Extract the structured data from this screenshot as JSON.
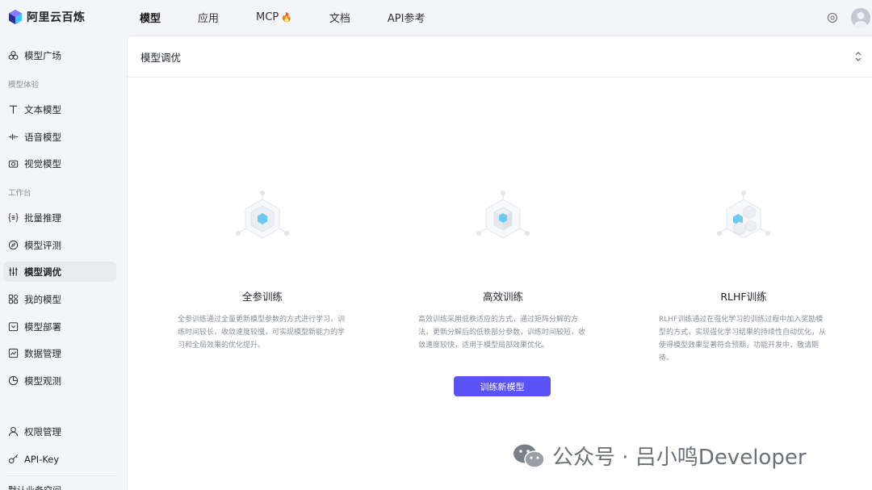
{
  "brand": {
    "name": "阿里云百炼"
  },
  "nav": [
    {
      "label": "模型",
      "active": true
    },
    {
      "label": "应用"
    },
    {
      "label": "MCP",
      "badge": "🔥"
    },
    {
      "label": "文档"
    },
    {
      "label": "API参考"
    }
  ],
  "sidebar": {
    "top_item": "模型广场",
    "group_experience": "模型体验",
    "experience_items": [
      "文本模型",
      "语音模型",
      "视觉模型"
    ],
    "group_workbench": "工作台",
    "workbench_items": [
      "批量推理",
      "模型评测",
      "模型调优",
      "我的模型",
      "模型部署",
      "数据管理",
      "模型观测"
    ],
    "bottom_items": [
      "权限管理",
      "API-Key"
    ],
    "footer_text": "默认业务空间"
  },
  "main": {
    "title": "模型调优",
    "cards": [
      {
        "title": "全参训练",
        "desc": "全参训练通过全量更新模型参数的方式进行学习，训练时间较长，收敛速度较慢，可实现模型新能力的学习和全局效果的优化提升。"
      },
      {
        "title": "高效训练",
        "desc": "高效训练采用低秩适应的方式，通过矩阵分解的方法，更新分解后的低秩部分参数，训练时间较短，收敛速度较快，适用于模型局部效果优化。"
      },
      {
        "title": "RLHF训练",
        "desc": "RLHF训练通过在强化学习的训练过程中加入奖励模型的方式，实现强化学习结果的持续性自动优化，从使得模型效果显著符合预期，功能开发中，敬请期待。"
      }
    ],
    "train_button": "训练新模型"
  },
  "watermark": {
    "text": "公众号 · 吕小鸣Developer"
  },
  "colors": {
    "accent": "#5b52f5",
    "sidebar_bg": "#f4f5f9",
    "muted": "#8a8f99"
  }
}
